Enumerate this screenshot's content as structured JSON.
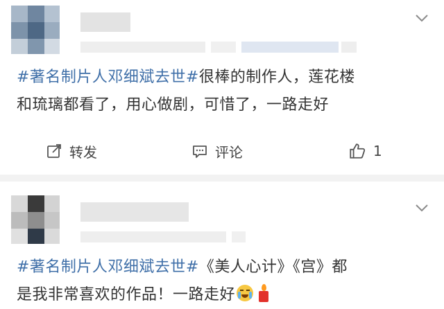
{
  "post1": {
    "hashtag": "#著名制片人邓细斌去世#",
    "text_line1_rest": "很棒的制作人，莲花楼",
    "text_line2": "和琉璃都看了，用心做剧，可惜了，一路走好",
    "actions": {
      "repost_label": "转发",
      "comment_label": "评论",
      "like_count": "1"
    }
  },
  "post2": {
    "hashtag": "#著名制片人邓细斌去世#",
    "text_line1_rest": "《美人心计》《宫》都",
    "text_line2": "是我非常喜欢的作品！一路走好"
  },
  "colors": {
    "hashtag": "#3f6fa8",
    "text": "#333333",
    "separator": "#f2f2f2"
  },
  "icons": [
    "chevron-down-icon",
    "repost-icon",
    "comment-icon",
    "like-icon",
    "crying-emoji-icon",
    "candle-emoji-icon"
  ]
}
